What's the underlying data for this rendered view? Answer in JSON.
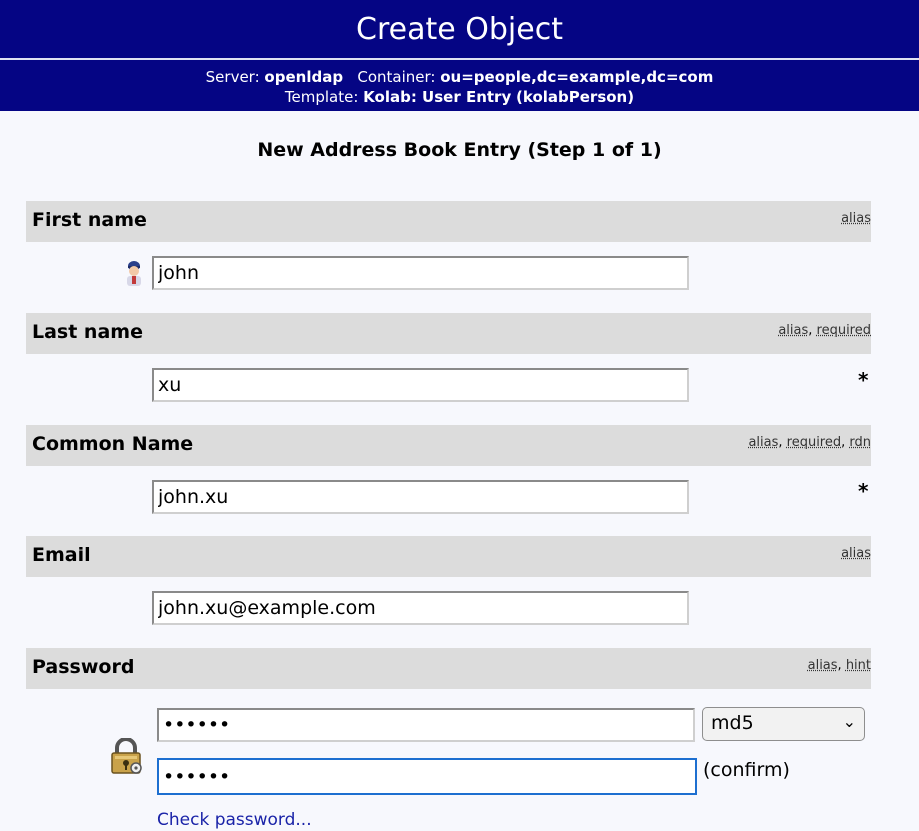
{
  "header": {
    "title": "Create Object",
    "server_label": "Server:",
    "server_value": "openldap",
    "container_label": "Container:",
    "container_value": "ou=people,dc=example,dc=com",
    "template_label": "Template:",
    "template_value": "Kolab: User Entry",
    "template_class": "(kolabPerson)"
  },
  "form": {
    "heading": "New Address Book Entry (Step 1 of 1)",
    "first_name": {
      "label": "First name",
      "flags": [
        "alias"
      ],
      "value": "john",
      "icon": "user-icon"
    },
    "last_name": {
      "label": "Last name",
      "flags": [
        "alias",
        "required"
      ],
      "value": "xu",
      "required_mark": "*"
    },
    "common_name": {
      "label": "Common Name",
      "flags": [
        "alias",
        "required",
        "rdn"
      ],
      "value": "john.xu",
      "required_mark": "*"
    },
    "email": {
      "label": "Email",
      "flags": [
        "alias"
      ],
      "value": "john.xu@example.com"
    },
    "password": {
      "label": "Password",
      "flags": [
        "alias",
        "hint"
      ],
      "value": "••••••",
      "confirm_value": "••••••",
      "hash_selected": "md5",
      "confirm_label": "(confirm)",
      "check_link": "Check password...",
      "icon": "lock-icon"
    }
  },
  "colors": {
    "header_bg": "#050584",
    "section_bg": "#dcdcdc",
    "page_bg": "#f7f8fd",
    "link": "#1a23a8",
    "focus": "#1d6fd0"
  }
}
